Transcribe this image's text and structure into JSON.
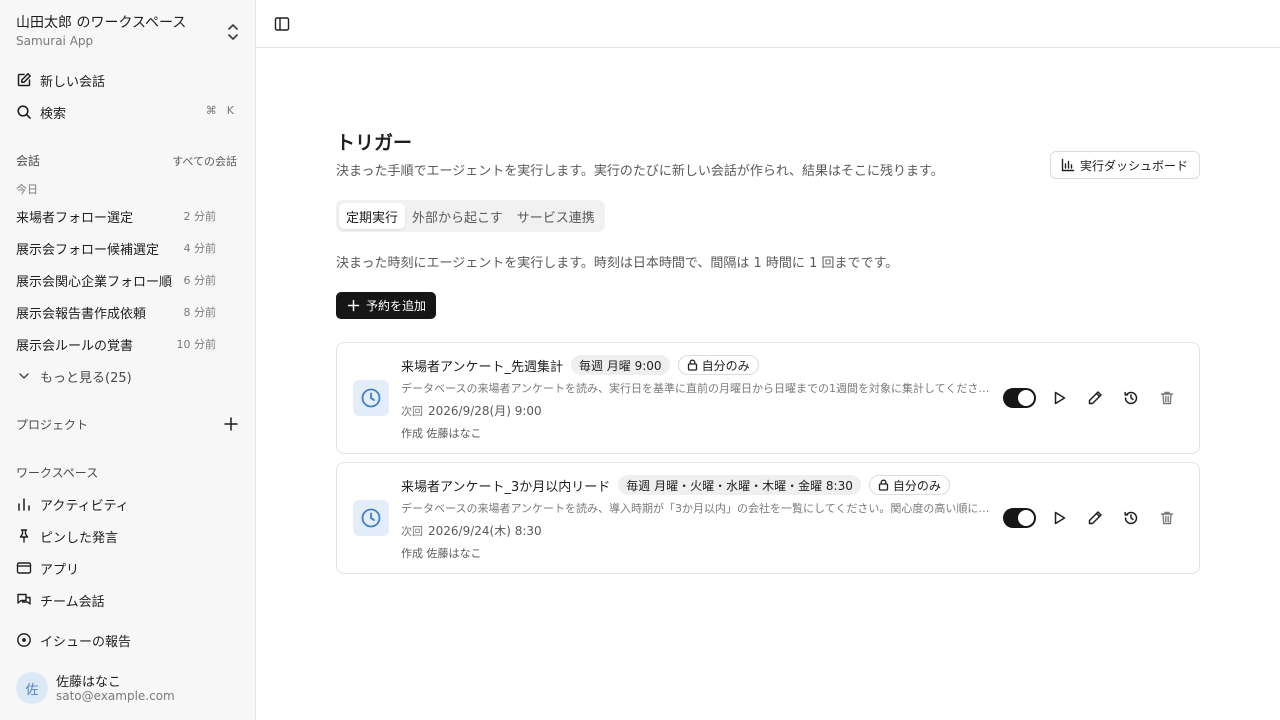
{
  "workspace": {
    "name": "山田太郎 のワークスペース",
    "app": "Samurai App"
  },
  "nav": {
    "new_chat": "新しい会話",
    "search": "検索",
    "search_shortcut": [
      "⌘",
      "K"
    ]
  },
  "conversations": {
    "label": "会話",
    "all_link": "すべての会話",
    "group_today": "今日",
    "items": [
      {
        "title": "来場者フォロー選定",
        "age": "2 分前"
      },
      {
        "title": "展示会フォロー候補選定",
        "age": "4 分前"
      },
      {
        "title": "展示会関心企業フォロー順",
        "age": "6 分前"
      },
      {
        "title": "展示会報告書作成依頼",
        "age": "8 分前"
      },
      {
        "title": "展示会ルールの覚書",
        "age": "10 分前"
      }
    ],
    "more": "もっと見る(25)"
  },
  "projects": {
    "label": "プロジェクト"
  },
  "workspace_section": {
    "label": "ワークスペース",
    "items": [
      "アクティビティ",
      "ピンした発言",
      "アプリ",
      "チーム会話"
    ]
  },
  "report_issue": "イシューの報告",
  "user": {
    "initial": "佐",
    "name": "佐藤はなこ",
    "email": "sato@example.com"
  },
  "page": {
    "title": "トリガー",
    "description": "決まった手順でエージェントを実行します。実行のたびに新しい会話が作られ、結果はそこに残ります。",
    "dashboard_button": "実行ダッシュボード",
    "tabs": [
      "定期実行",
      "外部から起こす",
      "サービス連携"
    ],
    "active_tab": "定期実行",
    "tab_description": "決まった時刻にエージェントを実行します。時刻は日本時間で、間隔は 1 時間に 1 回までです。",
    "add_button": "予約を追加"
  },
  "triggers": [
    {
      "name": "来場者アンケート_先週集計",
      "schedule": "毎週 月曜 9:00",
      "visibility": "自分のみ",
      "description": "データベースの来場者アンケートを読み、実行日を基準に直前の月曜日から日曜までの1週間を対象に集計してください…",
      "next_label": "次回",
      "next_time": "2026/9/28(月) 9:00",
      "owner": "作成 佐藤はなこ",
      "enabled": true
    },
    {
      "name": "来場者アンケート_3か月以内リード",
      "schedule": "毎週 月曜・火曜・水曜・木曜・金曜 8:30",
      "visibility": "自分のみ",
      "description": "データベースの来場者アンケートを読み、導入時期が「3か月以内」の会社を一覧にしてください。関心度の高い順に…",
      "next_label": "次回",
      "next_time": "2026/9/24(木) 8:30",
      "owner": "作成 佐藤はなこ",
      "enabled": true
    }
  ],
  "colors": {
    "accent_icon_bg": "#e3eefa",
    "accent_icon": "#3f7fc6",
    "dark": "#161616"
  }
}
